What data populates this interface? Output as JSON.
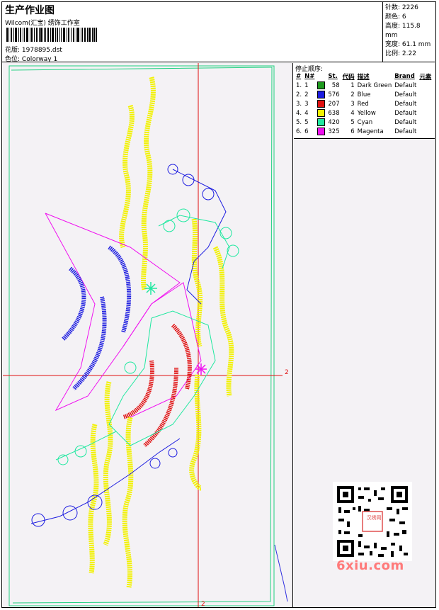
{
  "header": {
    "title": "生产作业图",
    "subtitle": "Wilcom(汇宝) 绣饰工作室",
    "design_label": "花版:",
    "design_value": "1978895.dst",
    "colorway_label": "色位:",
    "colorway_value": "Colorway 1"
  },
  "stats": {
    "stitches": "针数: 2226",
    "colors": "颜色: 6",
    "height": "高度: 115.8 mm",
    "width": "宽度: 61.1 mm",
    "ratio": "比例: 2.22"
  },
  "color_table": {
    "title": "停止顺序:",
    "headers": [
      "#",
      "N#",
      "St.",
      "代码",
      "描述",
      "Brand",
      "元素"
    ],
    "rows": [
      {
        "idx": "1.",
        "n": "1",
        "st": "58",
        "code": "1",
        "desc": "Dark Green",
        "brand": "Default",
        "color": "#1e9a1e"
      },
      {
        "idx": "2.",
        "n": "2",
        "st": "576",
        "code": "2",
        "desc": "Blue",
        "brand": "Default",
        "color": "#1c1ce0"
      },
      {
        "idx": "3.",
        "n": "3",
        "st": "207",
        "code": "3",
        "desc": "Red",
        "brand": "Default",
        "color": "#e01010"
      },
      {
        "idx": "4.",
        "n": "4",
        "st": "638",
        "code": "4",
        "desc": "Yellow",
        "brand": "Default",
        "color": "#f2f200"
      },
      {
        "idx": "5.",
        "n": "5",
        "st": "420",
        "code": "5",
        "desc": "Cyan",
        "brand": "Default",
        "color": "#20e8a0"
      },
      {
        "idx": "6.",
        "n": "6",
        "st": "325",
        "code": "6",
        "desc": "Magenta",
        "brand": "Default",
        "color": "#f010f0"
      }
    ]
  },
  "canvas": {
    "axis_label_right": "2",
    "axis_label_bottom": "2"
  },
  "watermark": {
    "site": "6xiu.com",
    "seal": "汉绣网"
  }
}
